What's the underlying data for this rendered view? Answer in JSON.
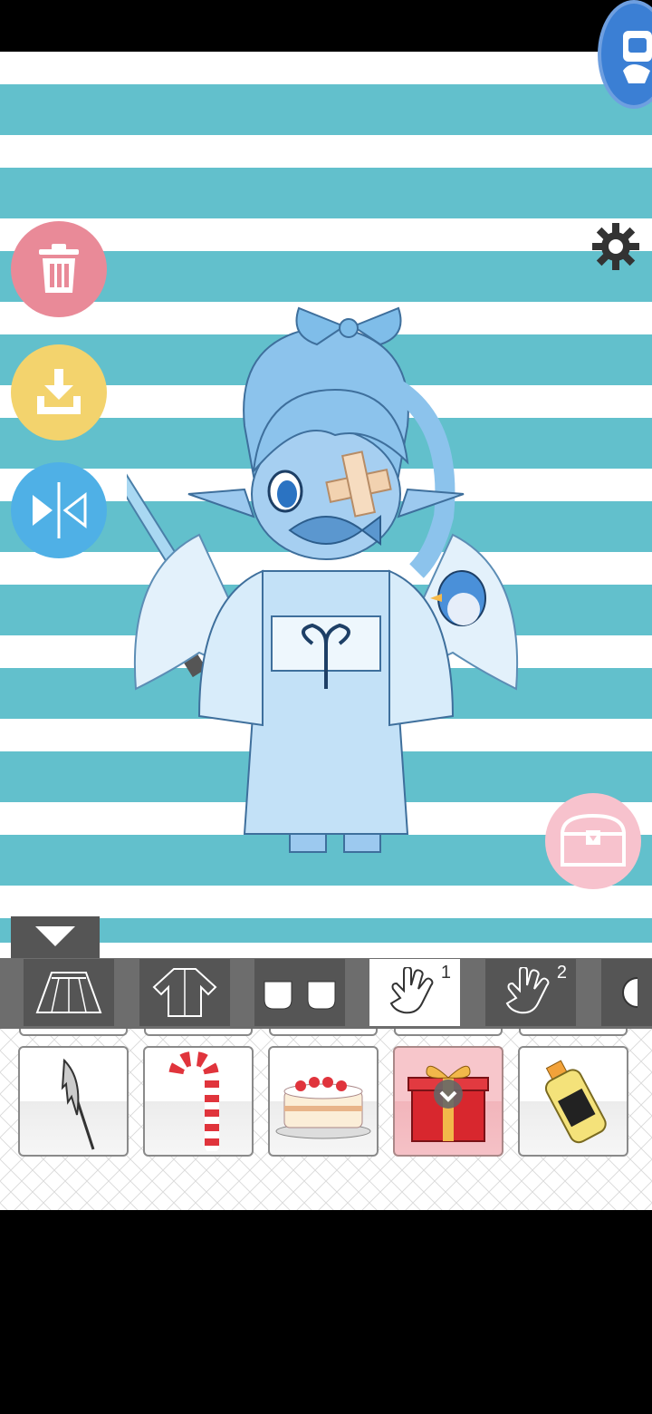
{
  "app": {
    "colors": {
      "stripe": "#62c0cc",
      "trash": "#e98a98",
      "download": "#f3d36d",
      "flip": "#4fb0e6",
      "chest": "#f7c2cd",
      "panel": "#555555",
      "selected_item": "#f7c6cb"
    }
  },
  "icons": {
    "top_corner": "assistant-avatar-icon",
    "trash": "trash-icon",
    "download": "download-icon",
    "flip": "flip-horizontal-icon",
    "settings": "gear-icon",
    "chest": "treasure-chest-icon",
    "collapse": "triangle-down-icon"
  },
  "categories": [
    {
      "icon": "skirt-icon",
      "number": ""
    },
    {
      "icon": "jacket-icon",
      "number": ""
    },
    {
      "icon": "socks-icon",
      "number": ""
    },
    {
      "icon": "hand-item-icon",
      "number": "1",
      "active": true
    },
    {
      "icon": "hand-item-icon",
      "number": "2"
    },
    {
      "icon": "accessory-icon",
      "number": ""
    }
  ],
  "items": [
    {
      "icon": "scythe-blade-icon",
      "selected": false
    },
    {
      "icon": "candy-cane-icon",
      "selected": false
    },
    {
      "icon": "cake-icon",
      "selected": false
    },
    {
      "icon": "gift-box-icon",
      "selected": true
    },
    {
      "icon": "bottle-icon",
      "selected": false
    }
  ]
}
